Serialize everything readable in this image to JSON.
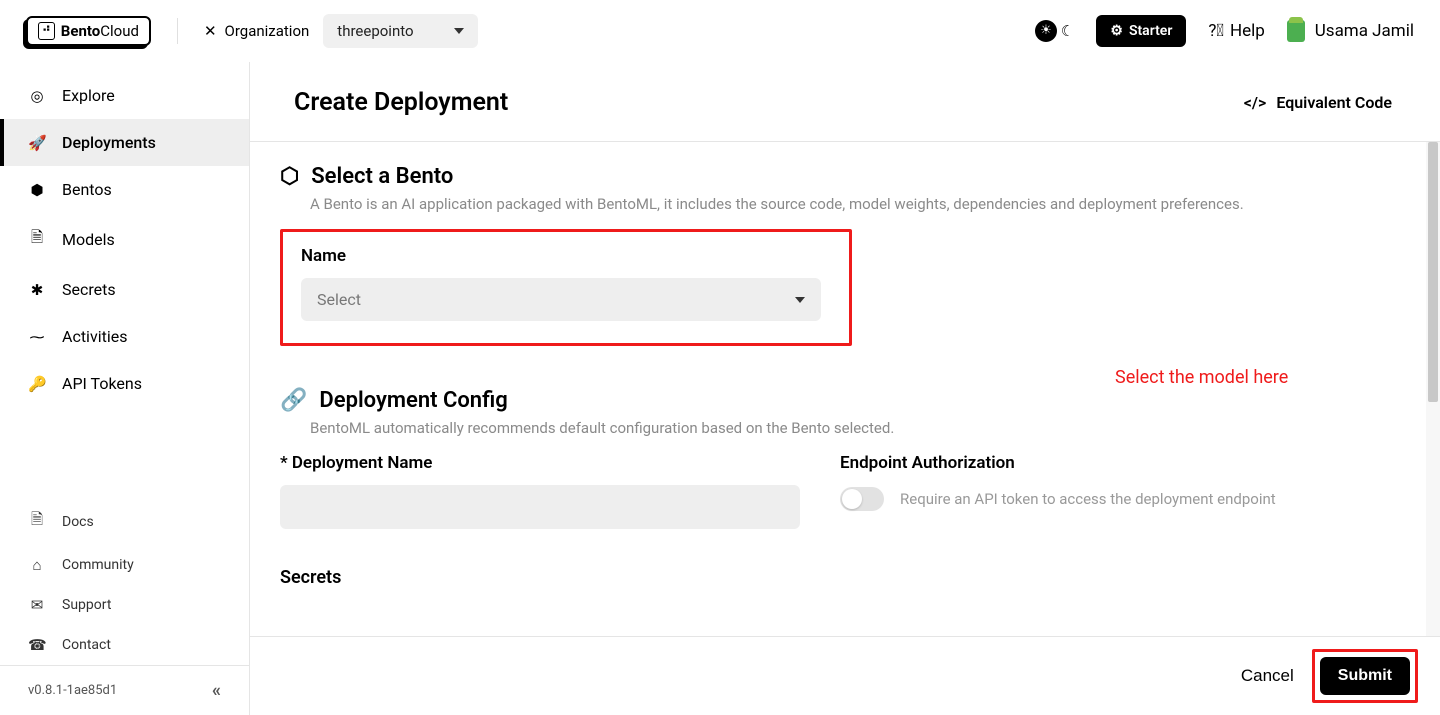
{
  "header": {
    "logo_bento": "Bento",
    "logo_cloud": "Cloud",
    "org_label": "Organization",
    "org_value": "threepointo",
    "starter": "Starter",
    "help": "Help",
    "user_name": "Usama Jamil"
  },
  "sidebar": {
    "items": [
      {
        "label": "Explore",
        "icon": "◎"
      },
      {
        "label": "Deployments",
        "icon": "🚀"
      },
      {
        "label": "Bentos",
        "icon": "⬢"
      },
      {
        "label": "Models",
        "icon": "🗎"
      },
      {
        "label": "Secrets",
        "icon": "✱"
      },
      {
        "label": "Activities",
        "icon": "⁓"
      },
      {
        "label": "API Tokens",
        "icon": "🔑"
      }
    ],
    "bottom": [
      {
        "label": "Docs",
        "icon": "🗎"
      },
      {
        "label": "Community",
        "icon": "⌂"
      },
      {
        "label": "Support",
        "icon": "✉"
      },
      {
        "label": "Contact",
        "icon": "☎"
      }
    ],
    "version": "v0.8.1-1ae85d1"
  },
  "page": {
    "title": "Create Deployment",
    "equiv_code": "Equivalent Code"
  },
  "select_bento": {
    "heading": "Select a Bento",
    "subtitle": "A Bento is an AI application packaged with BentoML, it includes the source code, model weights, dependencies and deployment preferences.",
    "name_label": "Name",
    "placeholder": "Select",
    "annotation": "Select the model here"
  },
  "deployment_config": {
    "heading": "Deployment Config",
    "subtitle": "BentoML automatically recommends default configuration based on the Bento selected.",
    "name_label": "* Deployment Name",
    "endpoint_heading": "Endpoint Authorization",
    "endpoint_desc": "Require an API token to access the deployment endpoint",
    "secrets_heading": "Secrets"
  },
  "footer": {
    "cancel": "Cancel",
    "submit": "Submit"
  }
}
